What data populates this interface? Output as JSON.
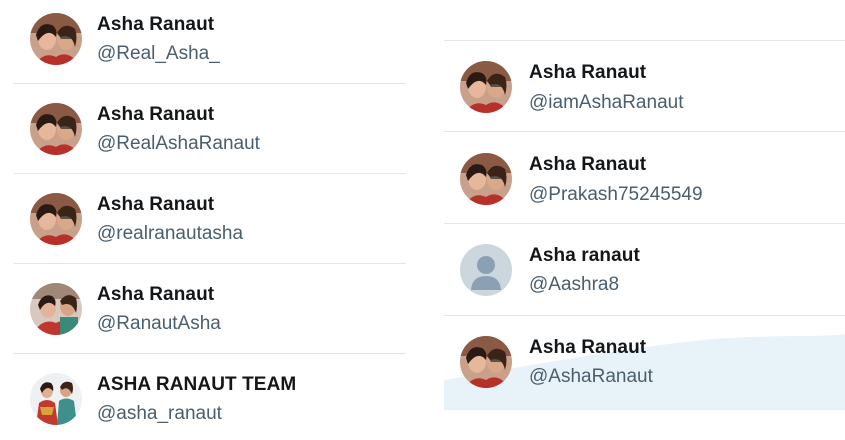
{
  "left_column": [
    {
      "name": "Asha Ranaut",
      "handle": "@Real_Asha_",
      "avatar": "photo-avatar"
    },
    {
      "name": "Asha Ranaut",
      "handle": "@RealAshaRanaut",
      "avatar": "photo-avatar"
    },
    {
      "name": "Asha Ranaut",
      "handle": "@realranautasha",
      "avatar": "photo-avatar"
    },
    {
      "name": "Asha Ranaut",
      "handle": "@RanautAsha",
      "avatar": "photo-avatar"
    },
    {
      "name": "ASHA RANAUT TEAM",
      "handle": "@asha_ranaut",
      "avatar": "photo-avatar"
    }
  ],
  "right_column": [
    {
      "name": "Asha Ranaut",
      "handle": "@iamAshaRanaut",
      "avatar": "photo-avatar"
    },
    {
      "name": "Asha Ranaut",
      "handle": "@Prakash75245549",
      "avatar": "photo-avatar"
    },
    {
      "name": "Asha ranaut",
      "handle": "@Aashra8",
      "avatar": "default-profile-icon"
    },
    {
      "name": "Asha Ranaut",
      "handle": "@AshaRanaut",
      "avatar": "photo-avatar"
    }
  ],
  "colors": {
    "name_text": "#14171a",
    "handle_text": "#4a5e6e",
    "divider": "#e3e6e8",
    "default_avatar_bg": "#ccd6dd",
    "default_avatar_fg": "#8ca0b3",
    "highlight_wave": "#e8f2f9"
  }
}
